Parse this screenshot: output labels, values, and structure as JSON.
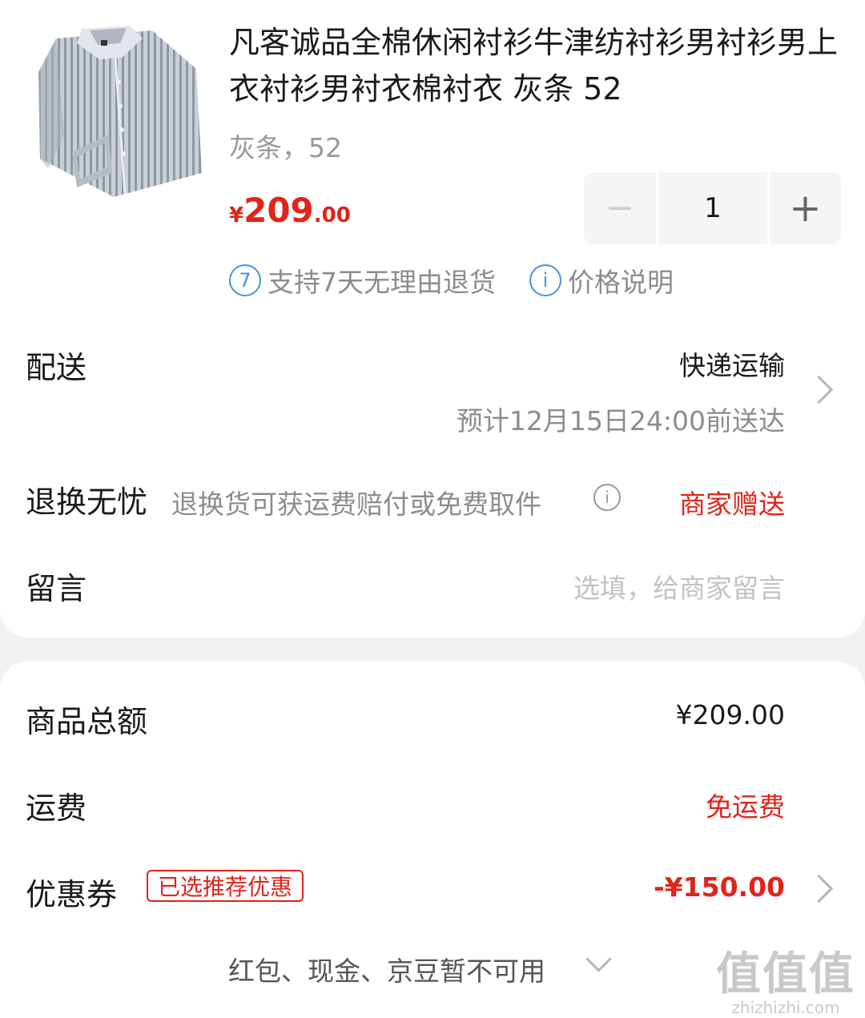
{
  "product": {
    "title": "凡客诚品全棉休闲衬衫牛津纺衬衫男衬衫男上衣衬衫男衬衣棉衬衣 灰条 52",
    "variant": "灰条，52",
    "price_symbol": "¥",
    "price_int": "209",
    "price_dec": ".00",
    "quantity": "1",
    "quantity_minus": "−",
    "quantity_plus": "+",
    "service_return_icon": "7",
    "service_return": "支持7天无理由退货",
    "service_price_icon": "i",
    "service_price": "价格说明"
  },
  "delivery": {
    "label": "配送",
    "method": "快递运输",
    "eta": "预计12月15日24:00前送达"
  },
  "returns": {
    "label": "退换无忧",
    "desc": "退换货可获运费赔付或免费取件",
    "info_icon": "i",
    "value": "商家赠送"
  },
  "message": {
    "label": "留言",
    "placeholder": "选填，给商家留言"
  },
  "summary": {
    "subtotal_label": "商品总额",
    "subtotal_value": "¥209.00",
    "shipping_label": "运费",
    "shipping_value": "免运费",
    "coupon_label": "优惠券",
    "coupon_badge": "已选推荐优惠",
    "coupon_value": "-¥150.00",
    "unavailable": "红包、现金、京豆暂不可用"
  },
  "watermark": {
    "logo": "值值值",
    "site": "zhizhizhi.com"
  },
  "colors": {
    "accent_red": "#e2231a",
    "info_blue": "#4a90e2",
    "muted": "#999999",
    "background": "#f2f2f2"
  },
  "icons": [
    "shirt-thumbnail",
    "minus-icon",
    "plus-icon",
    "return-7day-icon",
    "info-icon",
    "chevron-right-icon",
    "chevron-down-icon"
  ]
}
